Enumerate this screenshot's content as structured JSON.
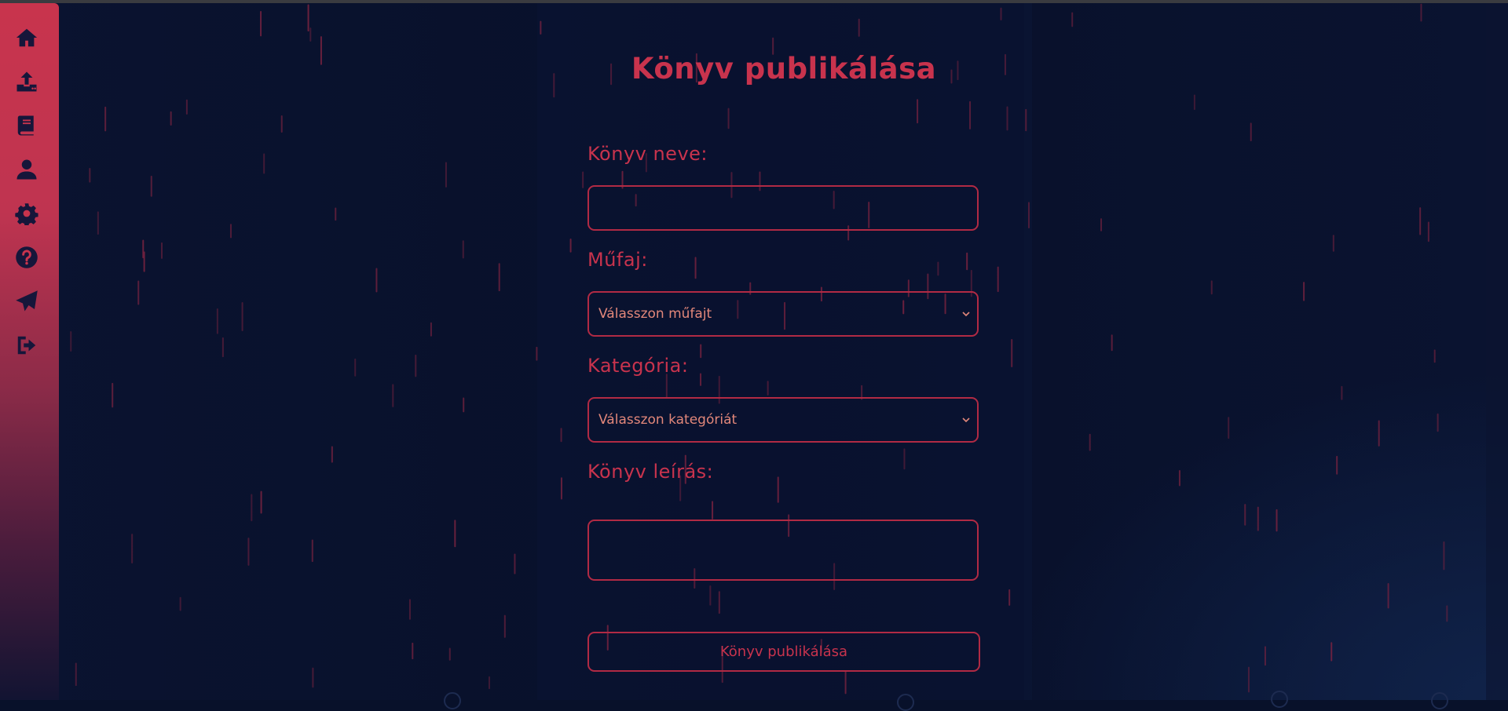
{
  "sidebar": {
    "items": [
      {
        "icon": "home-icon"
      },
      {
        "icon": "upload-icon"
      },
      {
        "icon": "book-icon"
      },
      {
        "icon": "user-icon"
      },
      {
        "icon": "gear-icon"
      },
      {
        "icon": "question-icon"
      },
      {
        "icon": "paper-plane-icon"
      },
      {
        "icon": "logout-icon"
      }
    ]
  },
  "form": {
    "title": "Könyv publikálása",
    "book_name_label": "Könyv neve:",
    "book_name_value": "",
    "genre_label": "Műfaj:",
    "genre_selected": "Válasszon műfajt",
    "category_label": "Kategória:",
    "category_selected": "Válasszon kategóriát",
    "description_label": "Könyv leírás:",
    "description_value": "",
    "submit_label": "Könyv publikálása"
  },
  "colors": {
    "accent": "#c8334d",
    "border": "#b12a44",
    "select_text": "#e2877a",
    "background": "#08112a",
    "sidebar_icon": "#16163a"
  }
}
